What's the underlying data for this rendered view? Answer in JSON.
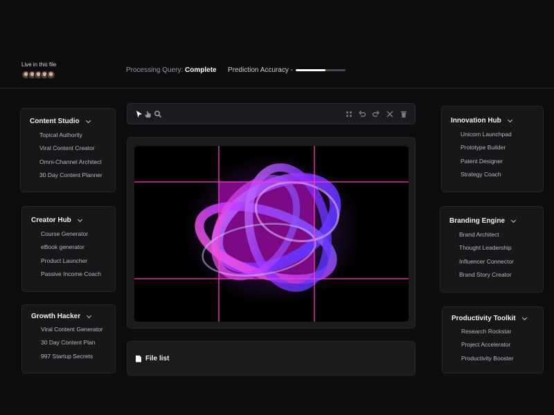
{
  "header": {
    "live_label": "Live in this file",
    "avatar_count": 5,
    "status_label": "Processing Query:",
    "status_value": "Complete",
    "accuracy_label": "Prediction Accuracy -",
    "accuracy_fraction": 0.6
  },
  "left_panels": [
    {
      "title": "Content Studio",
      "items": [
        "Topical Authority",
        "Viral Content Creator",
        "Omni-Channel Architect",
        "30 Day Content Planner"
      ]
    },
    {
      "title": "Creator Hub",
      "items": [
        "Course Generator",
        "eBook generator",
        "Product Launcher",
        "Passive Income Coach"
      ]
    },
    {
      "title": "Growth Hacker",
      "items": [
        "Viral Content Generator",
        "30 Day Content Plan",
        "997 Startup Secrets"
      ]
    }
  ],
  "right_panels": [
    {
      "title": "Innovation Hub",
      "items": [
        "Unicorn Launchpad",
        "Prototype Builder",
        "Patent Designer",
        "Strategy Coach"
      ]
    },
    {
      "title": "Branding Engine",
      "items": [
        "Brand Architect",
        "Thought Leadership",
        "Influencer Connector",
        "Brand Story Creator"
      ]
    },
    {
      "title": "Productivity Toolkit",
      "items": [
        "Research Rockstar",
        "Project Accelerator",
        "Productivity Booster"
      ]
    }
  ],
  "toolbar": {
    "tools": [
      "pointer-icon",
      "hand-icon",
      "zoom-icon",
      "grid-icon",
      "undo-icon",
      "redo-icon",
      "close-icon",
      "trash-icon"
    ]
  },
  "canvas": {
    "guide_color": "#ff3fb4",
    "selection_color": "#7b0a84",
    "accent_colors": [
      "#b13cff",
      "#6a3cff",
      "#ff4fd8"
    ]
  },
  "file_list": {
    "label": "File list"
  }
}
